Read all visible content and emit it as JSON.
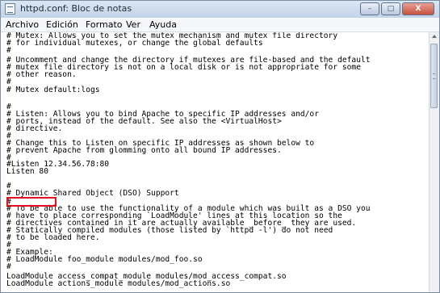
{
  "window": {
    "title": "httpd.conf: Bloc de notas",
    "icon": "notepad-icon",
    "buttons": {
      "minimize": "–",
      "maximize": "□",
      "close": "X"
    }
  },
  "menu": [
    {
      "label": "Archivo"
    },
    {
      "label": "Edición"
    },
    {
      "label": "Formato"
    },
    {
      "label": "Ver"
    },
    {
      "label": "Ayuda"
    }
  ],
  "editor": {
    "lines": [
      "# Mutex: Allows you to set the mutex mechanism and mutex file directory",
      "# for individual mutexes, or change the global defaults",
      "#",
      "# Uncomment and change the directory if mutexes are file-based and the default",
      "# mutex file directory is not on a local disk or is not appropriate for some",
      "# other reason.",
      "#",
      "# Mutex default:logs",
      "",
      "#",
      "# Listen: Allows you to bind Apache to specific IP addresses and/or",
      "# ports, instead of the default. See also the <VirtualHost>",
      "# directive.",
      "#",
      "# Change this to Listen on specific IP addresses as shown below to",
      "# prevent Apache from glomming onto all bound IP addresses.",
      "#",
      "#Listen 12.34.56.78:80",
      "Listen 80",
      "",
      "#",
      "# Dynamic Shared Object (DSO) Support",
      "#",
      "# To be able to use the functionality of a module which was built as a DSO you",
      "# have to place corresponding `LoadModule' lines at this location so the",
      "# directives contained in it are actually available _before_ they are used.",
      "# Statically compiled modules (those listed by `httpd -l') do not need",
      "# to be loaded here.",
      "#",
      "# Example:",
      "# LoadModule foo_module modules/mod_foo.so",
      "#",
      "LoadModule access_compat_module modules/mod_access_compat.so",
      "LoadModule actions_module modules/mod_actions.so"
    ]
  },
  "highlight_color": "#e01020"
}
